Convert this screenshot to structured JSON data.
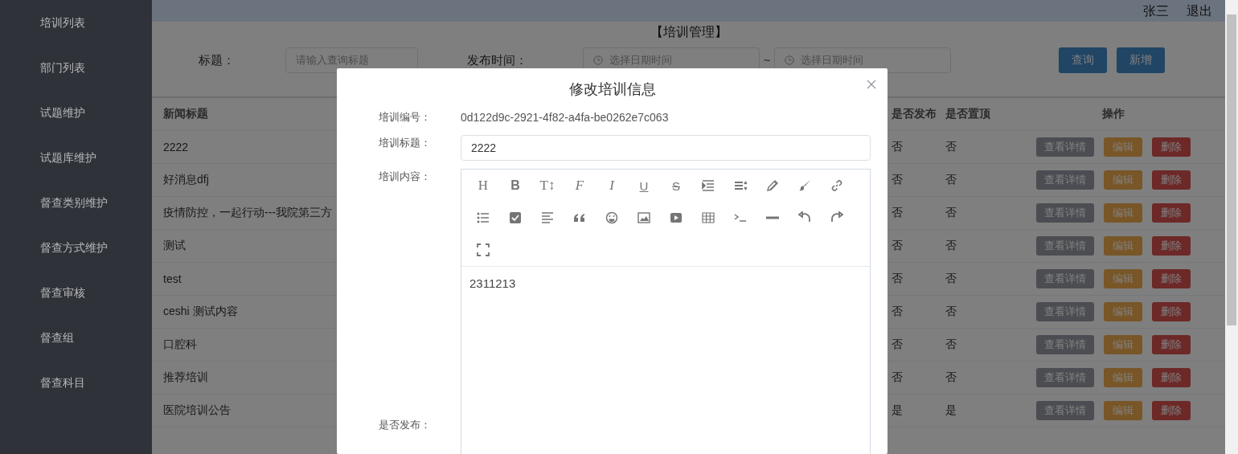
{
  "sidebar": {
    "items": [
      {
        "label": "培训列表"
      },
      {
        "label": "部门列表"
      },
      {
        "label": "试题维护"
      },
      {
        "label": "试题库维护"
      },
      {
        "label": "督查类别维护"
      },
      {
        "label": "督查方式维护"
      },
      {
        "label": "督查审核"
      },
      {
        "label": "督查组"
      },
      {
        "label": "督查科目"
      }
    ]
  },
  "header": {
    "user": "张三",
    "logout": "退出"
  },
  "page_title": "【培训管理】",
  "filters": {
    "title_label": "标题：",
    "title_placeholder": "请输入查询标题",
    "time_label": "发布时间：",
    "start_placeholder": "选择日期时间",
    "separator": "~",
    "end_placeholder": "选择日期时间"
  },
  "buttons": [
    {
      "label": "查询",
      "kind": "primary"
    },
    {
      "label": "新增",
      "kind": "primary"
    }
  ],
  "table": {
    "columns": [
      "新闻标题",
      "是否发布",
      "是否置顶",
      "操作"
    ],
    "rows": [
      {
        "title": "2222",
        "published": "否",
        "pinned": "否",
        "actions": [
          {
            "label": "查看详情",
            "kind": "view"
          },
          {
            "label": "编辑",
            "kind": "edit"
          },
          {
            "label": "删除",
            "kind": "delete"
          }
        ]
      },
      {
        "title": "好消息dfj",
        "published": "否",
        "pinned": "否",
        "actions": [
          {
            "label": "查看详情",
            "kind": "view"
          },
          {
            "label": "编辑",
            "kind": "edit"
          },
          {
            "label": "删除",
            "kind": "delete"
          }
        ]
      },
      {
        "title": "疫情防控，一起行动---我院第三方",
        "published": "否",
        "pinned": "否",
        "actions": [
          {
            "label": "查看详情",
            "kind": "view"
          },
          {
            "label": "编辑",
            "kind": "edit"
          },
          {
            "label": "删除",
            "kind": "delete"
          }
        ]
      },
      {
        "title": "测试",
        "published": "否",
        "pinned": "否",
        "actions": [
          {
            "label": "查看详情",
            "kind": "view"
          },
          {
            "label": "编辑",
            "kind": "edit"
          },
          {
            "label": "删除",
            "kind": "delete"
          }
        ]
      },
      {
        "title": "test",
        "published": "否",
        "pinned": "否",
        "actions": [
          {
            "label": "查看详情",
            "kind": "view"
          },
          {
            "label": "编辑",
            "kind": "edit"
          },
          {
            "label": "删除",
            "kind": "delete"
          }
        ]
      },
      {
        "title": "ceshi 测试内容",
        "published": "否",
        "pinned": "否",
        "actions": [
          {
            "label": "查看详情",
            "kind": "view"
          },
          {
            "label": "编辑",
            "kind": "edit"
          },
          {
            "label": "删除",
            "kind": "delete"
          }
        ]
      },
      {
        "title": "口腔科",
        "published": "否",
        "pinned": "否",
        "actions": [
          {
            "label": "查看详情",
            "kind": "view"
          },
          {
            "label": "编辑",
            "kind": "edit"
          },
          {
            "label": "删除",
            "kind": "delete"
          }
        ]
      },
      {
        "title": "推荐培训",
        "published": "否",
        "pinned": "否",
        "actions": [
          {
            "label": "查看详情",
            "kind": "view"
          },
          {
            "label": "编辑",
            "kind": "edit"
          },
          {
            "label": "删除",
            "kind": "delete"
          }
        ]
      },
      {
        "title": "医院培训公告",
        "published": "是",
        "pinned": "是",
        "actions": [
          {
            "label": "查看详情",
            "kind": "view"
          },
          {
            "label": "编辑",
            "kind": "edit"
          },
          {
            "label": "删除",
            "kind": "delete"
          }
        ]
      }
    ]
  },
  "dialog": {
    "title": "修改培训信息",
    "fields": [
      {
        "label": "培训编号：",
        "kind": "text",
        "value": "0d122d9c-2921-4f82-a4fa-be0262e7c063"
      },
      {
        "label": "培训标题：",
        "kind": "input",
        "value": "2222"
      },
      {
        "label": "培训内容：",
        "kind": "editor",
        "content": "2311213",
        "tools": [
          {
            "kind": "heading",
            "glyph": "H"
          },
          {
            "kind": "bold",
            "glyph": "B"
          },
          {
            "kind": "size",
            "glyph": "T↕"
          },
          {
            "kind": "font",
            "glyph": "F"
          },
          {
            "kind": "italic",
            "glyph": "I"
          },
          {
            "kind": "underline",
            "glyph": "U"
          },
          {
            "kind": "strike",
            "glyph": "S"
          },
          {
            "kind": "indent"
          },
          {
            "kind": "lineheight"
          },
          {
            "kind": "pen"
          },
          {
            "kind": "brush"
          },
          {
            "kind": "link"
          },
          {
            "kind": "list"
          },
          {
            "kind": "checkbox"
          },
          {
            "kind": "align"
          },
          {
            "kind": "quote"
          },
          {
            "kind": "emoji"
          },
          {
            "kind": "image"
          },
          {
            "kind": "video"
          },
          {
            "kind": "table"
          },
          {
            "kind": "terminal"
          },
          {
            "kind": "rule"
          },
          {
            "kind": "undo"
          },
          {
            "kind": "redo"
          },
          {
            "kind": "fullscreen"
          }
        ]
      },
      {
        "label": "是否发布：",
        "kind": "label"
      }
    ]
  }
}
